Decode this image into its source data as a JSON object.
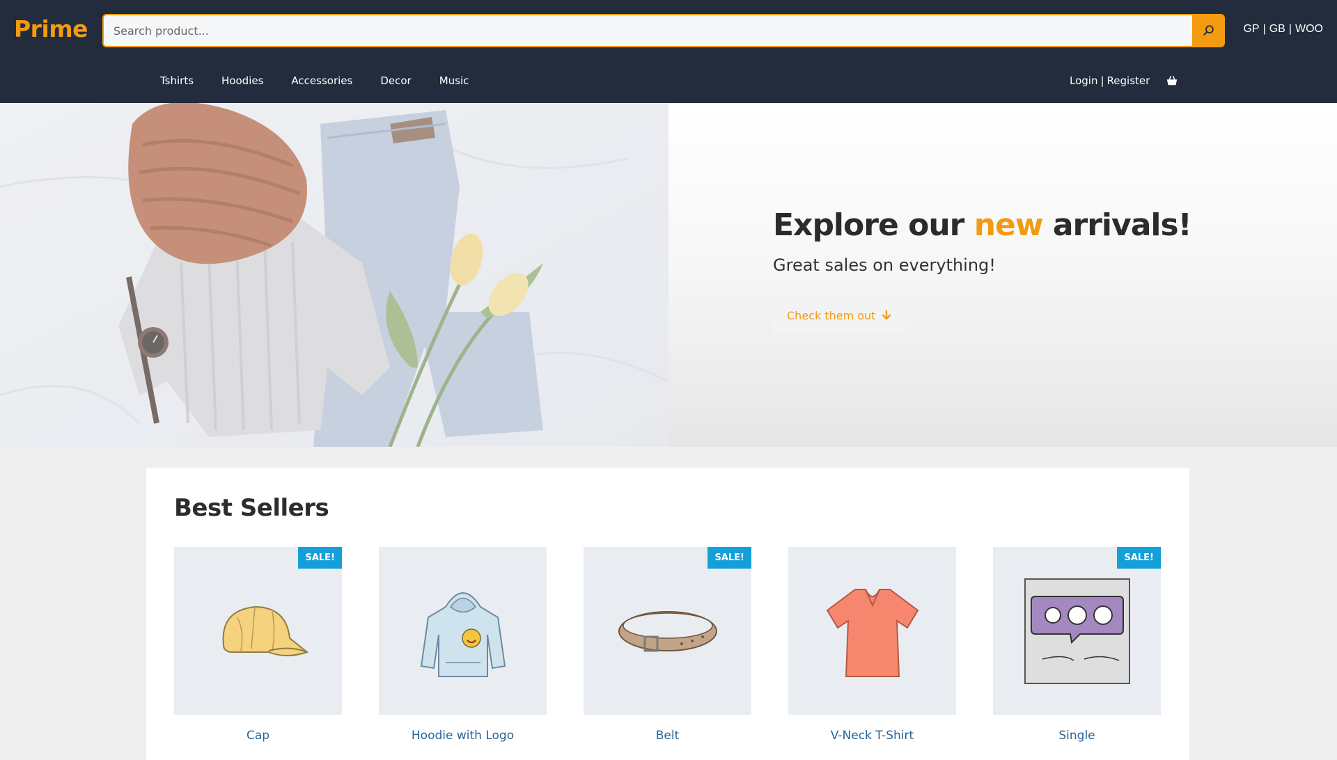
{
  "header": {
    "logo": "Prime",
    "search": {
      "placeholder": "Search product...",
      "value": ""
    },
    "locales": [
      "GP",
      "GB",
      "WOO"
    ],
    "nav": [
      "Tshirts",
      "Hoodies",
      "Accessories",
      "Decor",
      "Music"
    ],
    "account": {
      "login": "Login",
      "register": "Register"
    }
  },
  "hero": {
    "title_before": "Explore our ",
    "title_accent": "new",
    "title_after": " arrivals!",
    "subtitle": "Great sales on everything!",
    "cta": "Check them out"
  },
  "best_sellers": {
    "title": "Best Sellers",
    "sale_label": "SALE!",
    "products": [
      {
        "name": "Cap",
        "on_sale": true,
        "icon": "cap-icon"
      },
      {
        "name": "Hoodie with Logo",
        "on_sale": false,
        "icon": "hoodie-icon"
      },
      {
        "name": "Belt",
        "on_sale": true,
        "icon": "belt-icon"
      },
      {
        "name": "V-Neck T-Shirt",
        "on_sale": false,
        "icon": "tshirt-icon"
      },
      {
        "name": "Single",
        "on_sale": true,
        "icon": "woo-single-icon"
      }
    ]
  },
  "colors": {
    "header_bg": "#222c3d",
    "accent": "#f29b11",
    "sale_badge": "#13a0d8",
    "link": "#2a6496"
  }
}
